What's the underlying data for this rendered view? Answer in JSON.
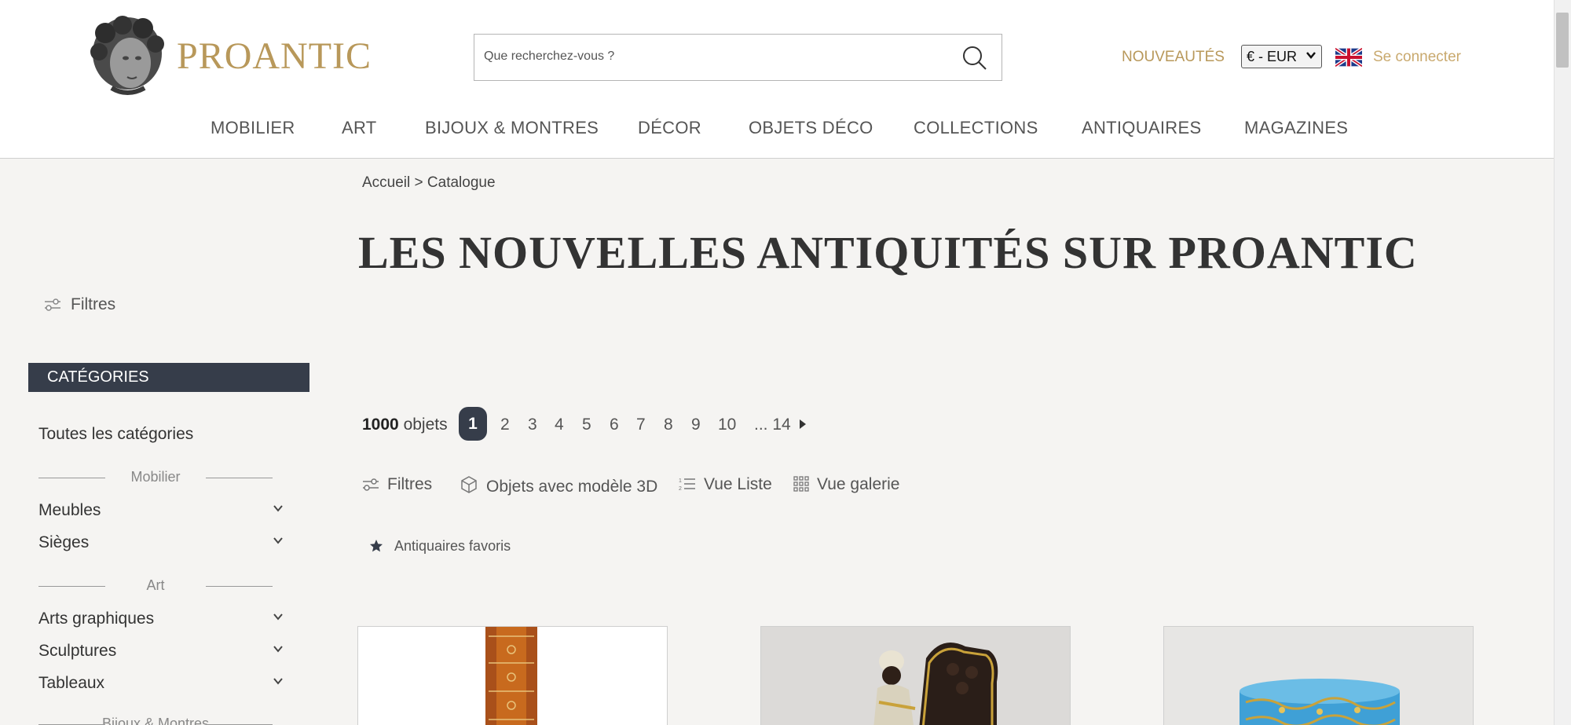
{
  "header": {
    "brand": "PROANTIC",
    "search_placeholder": "Que recherchez-vous ?",
    "nouveautes": "NOUVEAUTÉS",
    "currency": "€ - EUR",
    "signin": "Se connecter",
    "nav": [
      "MOBILIER",
      "ART",
      "BIJOUX & MONTRES",
      "DÉCOR",
      "OBJETS DÉCO",
      "COLLECTIONS",
      "ANTIQUAIRES",
      "MAGAZINES"
    ]
  },
  "breadcrumb": {
    "home": "Accueil",
    "sep": ">",
    "current": "Catalogue"
  },
  "title": "LES NOUVELLES ANTIQUITÉS SUR PROANTIC",
  "sidebar": {
    "filters": "Filtres",
    "categories_header": "CATÉGORIES",
    "all_categories": "Toutes les catégories",
    "groups": [
      {
        "label": "Mobilier",
        "items": [
          "Meubles",
          "Sièges"
        ]
      },
      {
        "label": "Art",
        "items": [
          "Arts graphiques",
          "Sculptures",
          "Tableaux"
        ]
      },
      {
        "label": "Bijoux & Montres",
        "items": []
      }
    ]
  },
  "pagination": {
    "count_number": "1000",
    "count_label": "objets",
    "current": "1",
    "pages": [
      "2",
      "3",
      "4",
      "5",
      "6",
      "7",
      "8",
      "9",
      "10"
    ],
    "last": "... 14"
  },
  "toolbar": {
    "filters": "Filtres",
    "models_3d": "Objets avec modèle 3D",
    "list_view": "Vue Liste",
    "gallery_view": "Vue galerie",
    "favorites": "Antiquaires favoris"
  },
  "colors": {
    "gold": "#b8985a",
    "navy": "#363d4a",
    "background": "#f5f4f2"
  }
}
